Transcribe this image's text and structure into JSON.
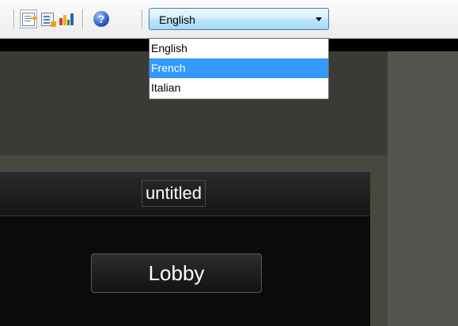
{
  "toolbar": {
    "icons": [
      "export-icon",
      "log-icon",
      "bar-chart-icon",
      "help-icon"
    ],
    "help_glyph": "?",
    "bar_colors": [
      "#e03a1e",
      "#f2b01e",
      "#3a8a2a",
      "#2c5fbf"
    ]
  },
  "language": {
    "selected": "English",
    "options": [
      "English",
      "French",
      "Italian"
    ],
    "highlighted": "French"
  },
  "panel": {
    "title": "untitled",
    "lobby_label": "Lobby"
  }
}
